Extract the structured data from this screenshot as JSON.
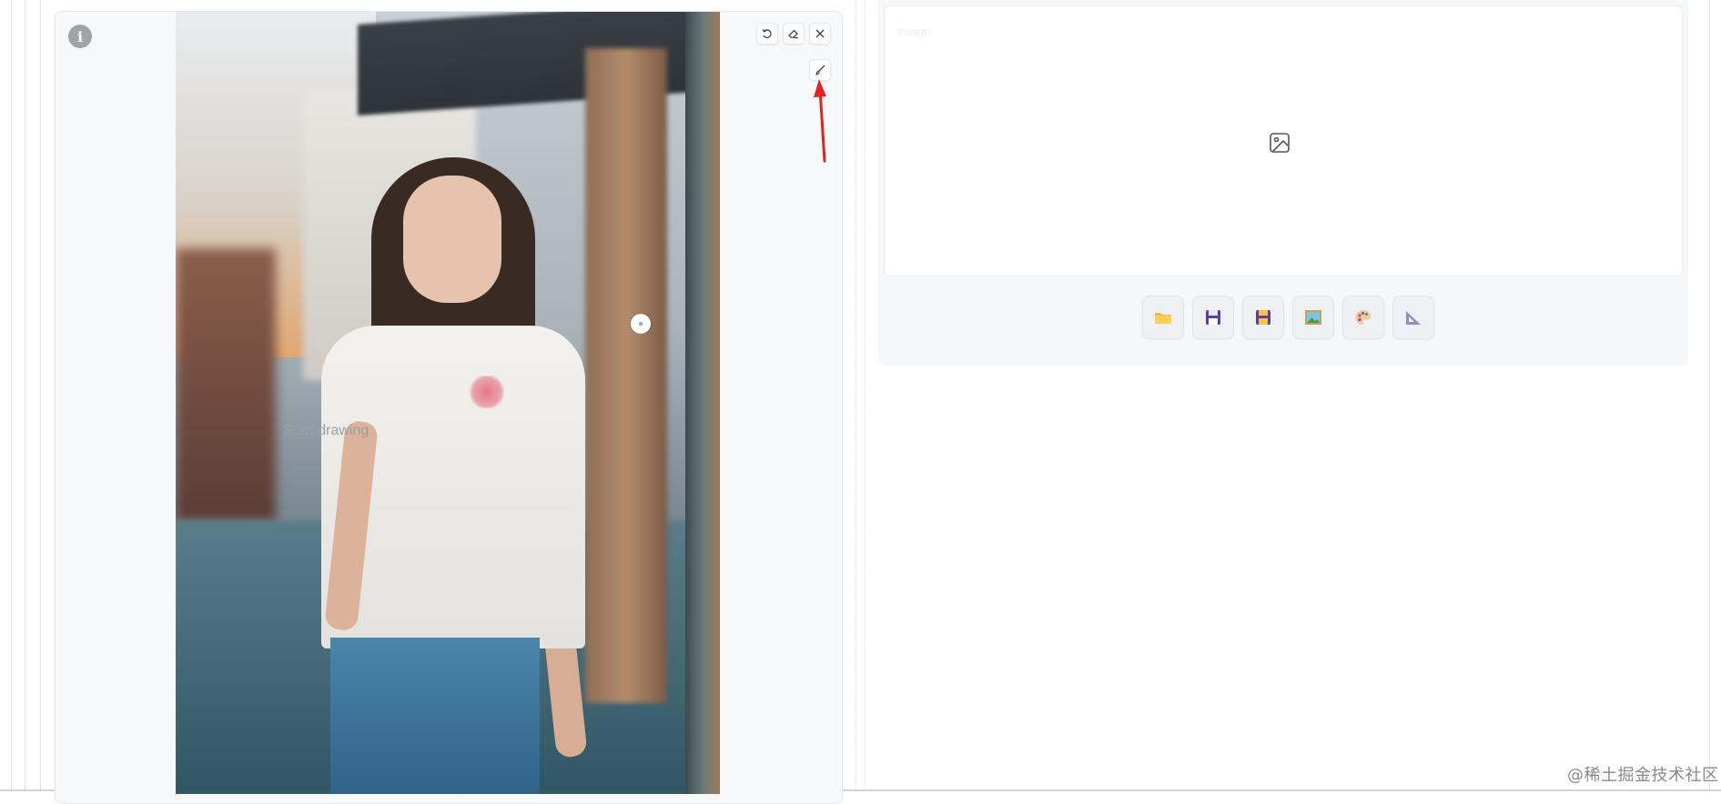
{
  "editor": {
    "canvas_hint": "Start drawing",
    "toolbar": {
      "undo_icon": "undo-icon",
      "clear_icon": "eraser-icon",
      "close_icon": "close-icon",
      "brush_icon": "brush-icon"
    },
    "info_icon": "info-icon",
    "info_symbol": "i",
    "annotation_arrow_color": "#e02424"
  },
  "output_panel": {
    "empty_label": "Image",
    "placeholder_icon": "image-icon",
    "buttons": [
      {
        "icon": "folder-icon",
        "emoji": "📁"
      },
      {
        "icon": "save-icon",
        "emoji": "💾"
      },
      {
        "icon": "save-to-library-icon",
        "emoji": "🗂"
      },
      {
        "icon": "picture-icon",
        "emoji": "🖼"
      },
      {
        "icon": "palette-icon",
        "emoji": "🎨"
      },
      {
        "icon": "triangle-ruler-icon",
        "emoji": "📐"
      }
    ]
  },
  "watermark": "@稀土掘金技术社区"
}
